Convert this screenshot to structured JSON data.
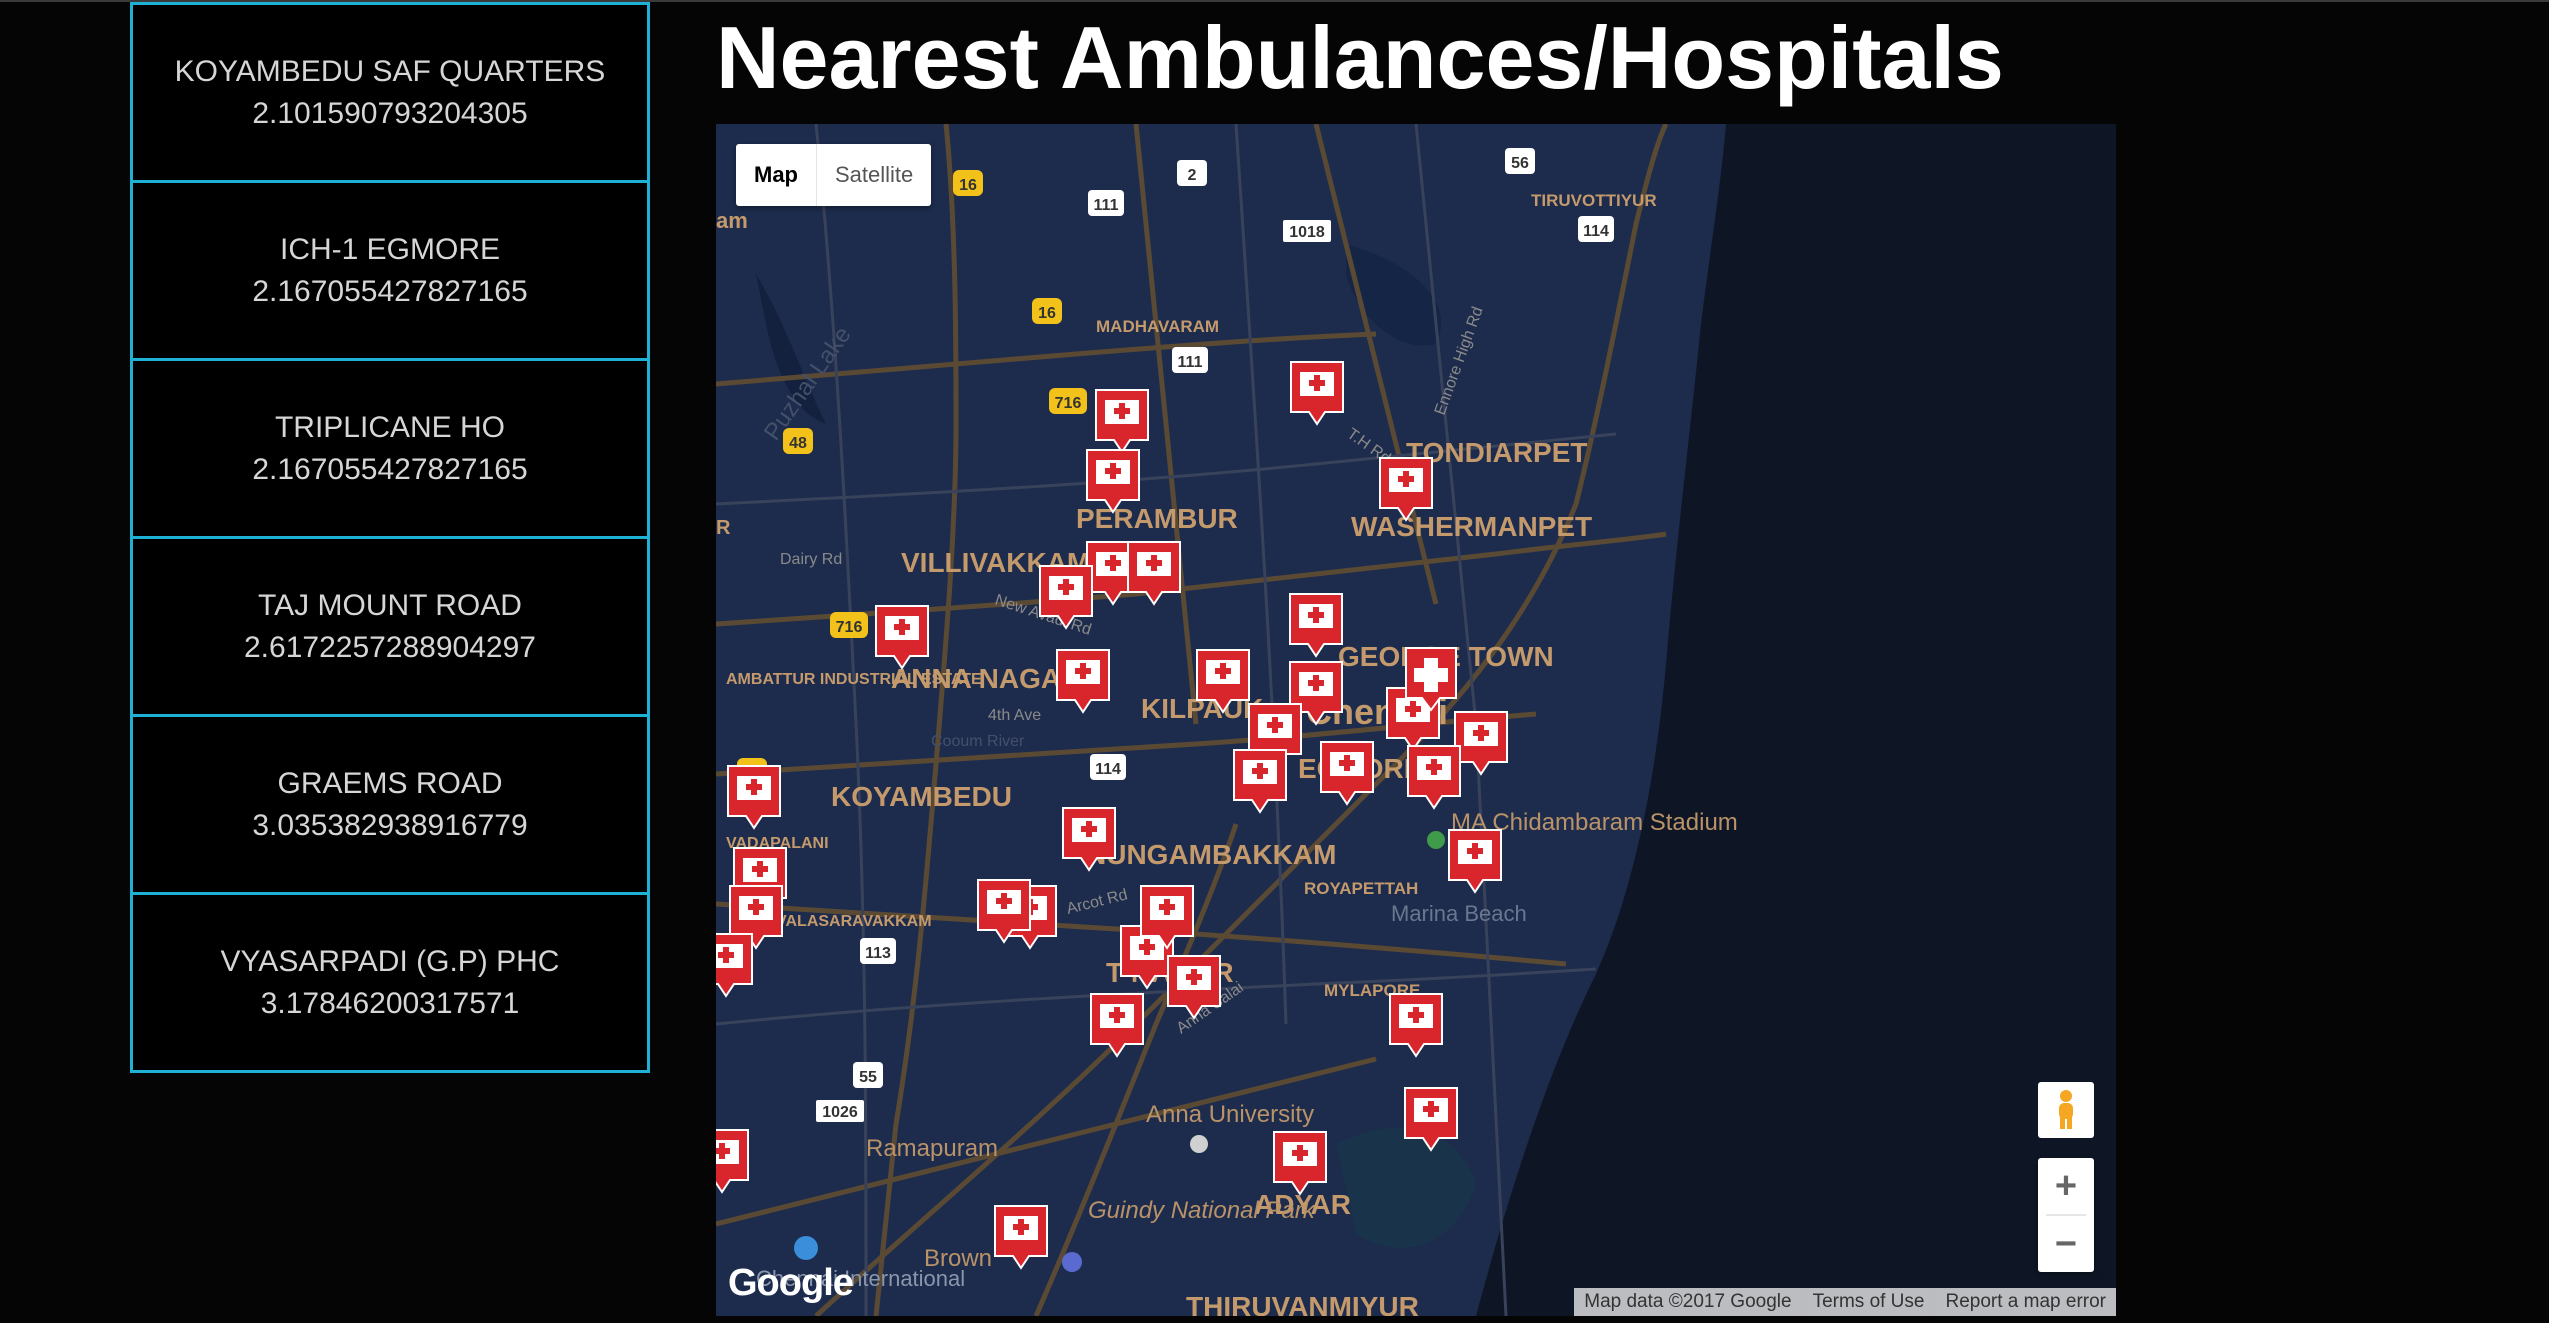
{
  "page": {
    "title": "Nearest Ambulances/Hospitals"
  },
  "list": [
    {
      "name": "KOYAMBEDU SAF QUARTERS",
      "distance": "2.101590793204305"
    },
    {
      "name": "ICH-1 EGMORE",
      "distance": "2.167055427827165"
    },
    {
      "name": "TRIPLICANE HO",
      "distance": "2.167055427827165"
    },
    {
      "name": "TAJ MOUNT ROAD",
      "distance": "2.6172257288904297"
    },
    {
      "name": "GRAEMS ROAD",
      "distance": "3.035382938916779"
    },
    {
      "name": "VYASARPADI (G.P) PHC",
      "distance": "3.17846200317571"
    }
  ],
  "map": {
    "type_control": {
      "map_label": "Map",
      "satellite_label": "Satellite",
      "selected": "Map"
    },
    "zoom": {
      "in_label": "+",
      "out_label": "−"
    },
    "logo": "Google",
    "attribution": {
      "data": "Map data ©2017 Google",
      "terms": "Terms of Use",
      "report": "Report a map error"
    },
    "area_labels": {
      "tiruvottiyur": "TIRUVOTTIYUR",
      "madhavaram": "MADHAVARAM",
      "tondiarpet": "TONDIARPET",
      "perambur": "PERAMBUR",
      "washermanpet": "WASHERMANPET",
      "villivakkam": "VILLIVAKKAM",
      "george_town": "GEORGE TOWN",
      "anna_nagar": "ANNA NAGAR",
      "kilpauk": "KILPAUK",
      "chennai": "Chennai",
      "egmore": "EGMORE",
      "koyambedu": "KOYAMBEDU",
      "nungambakkam": "NUNGAMBAKKAM",
      "royapettah": "ROYAPETTAH",
      "t_nagar": "T NAGAR",
      "mylapore": "MYLAPORE",
      "adyar": "ADYAR",
      "ramapuram": "Ramapuram",
      "anna_university": "Anna University",
      "guindy": "Guindy National Park",
      "stadium": "MA Chidambaram Stadium",
      "marina": "Marina Beach",
      "thiruvanmiyur": "THIRUVANMIYUR",
      "ambattur": "AMBATTUR INDUSTRIAL ESTATE",
      "vadapalani": "VADAPALANI",
      "valasaravakkam": "VALASARAVAKKAM",
      "airport": "Chennai International",
      "brown": "Brown",
      "puzhal": "Puzhal Lake",
      "dairy_rd": "Dairy Rd",
      "new_rd": "New Avadi Rd",
      "fourth_ave": "4th Ave",
      "cooum": "Cooum River",
      "arcot": "Arcot Rd",
      "th_rd": "T.H Rd",
      "ennore": "Ennore High Rd",
      "anna_salai": "Anna Salai",
      "am": "am",
      "r": "R"
    },
    "road_shields": [
      "16",
      "2",
      "56",
      "111",
      "1018",
      "114",
      "16",
      "111",
      "716",
      "48",
      "716",
      "114",
      "48",
      "113",
      "55",
      "1026"
    ],
    "colors": {
      "water": "#0e1626",
      "land": "#1d2c4d",
      "road": "#5b4a33",
      "marker": "#d9252c",
      "label": "#c49a6c"
    }
  }
}
